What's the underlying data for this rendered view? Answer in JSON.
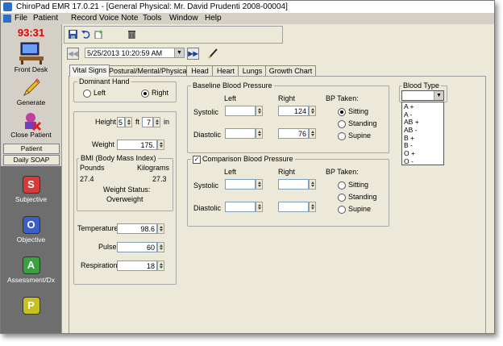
{
  "window": {
    "title": "ChiroPad EMR  17.0.21 - [General Physical:  Mr. David Prudenti 2008-00004]"
  },
  "menu": [
    "File",
    "Patient",
    "Record Voice Note",
    "Tools",
    "Window",
    "Help"
  ],
  "sidebar": {
    "clock": "93:31",
    "buttons": [
      "Front Desk",
      "Generate",
      "Close Patient"
    ],
    "tabs": [
      "Patient",
      "Daily SOAP"
    ],
    "soap": [
      {
        "letter": "S",
        "label": "Subjective",
        "color": "#d83a3a"
      },
      {
        "letter": "O",
        "label": "Objective",
        "color": "#3b5fc8"
      },
      {
        "letter": "A",
        "label": "Assessment/Dx",
        "color": "#3aa040"
      },
      {
        "letter": "P",
        "label": "",
        "color": "#c8c020"
      }
    ]
  },
  "visit": {
    "datetime": "5/25/2013 10:20:59 AM"
  },
  "tabs": [
    "Vital Signs",
    "Postural/Mental/Physical",
    "Head",
    "Heart",
    "Lungs",
    "Growth Chart"
  ],
  "dominant_hand": {
    "title": "Dominant Hand",
    "left": "Left",
    "right": "Right",
    "selected": "Right"
  },
  "height": {
    "label": "Height",
    "feet": "5",
    "ft": "ft",
    "inches": "7",
    "in": "in"
  },
  "weight": {
    "label": "Weight",
    "value": "175."
  },
  "bmi": {
    "title": "BMI (Body Mass Index)",
    "pounds_label": "Pounds",
    "kilograms_label": "Kilograms",
    "pounds": "27.4",
    "kilograms": "27.3",
    "status_label": "Weight Status:",
    "status": "Overweight"
  },
  "vitals": {
    "temperature_label": "Temperature",
    "temperature": "98.6",
    "pulse_label": "Pulse",
    "pulse": "60",
    "respiration_label": "Respiration",
    "respiration": "18"
  },
  "baseline_bp": {
    "title": "Baseline Blood Pressure",
    "left": "Left",
    "right": "Right",
    "systolic_label": "Systolic",
    "diastolic_label": "Diastolic",
    "systolic_right": "124",
    "diastolic_right": "76",
    "bp_taken": "BP Taken:",
    "positions": [
      "Sitting",
      "Standing",
      "Supine"
    ],
    "selected": "Sitting"
  },
  "comparison_bp": {
    "title": "Comparison Blood Pressure",
    "checked": true,
    "left": "Left",
    "right": "Right",
    "systolic_label": "Systolic",
    "diastolic_label": "Diastolic",
    "bp_taken": "BP Taken:",
    "positions": [
      "Sitting",
      "Standing",
      "Supine"
    ]
  },
  "blood_type": {
    "label": "Blood Type",
    "options": [
      "A +",
      "A -",
      "AB +",
      "AB -",
      "B +",
      "B -",
      "O +",
      "O -"
    ]
  }
}
